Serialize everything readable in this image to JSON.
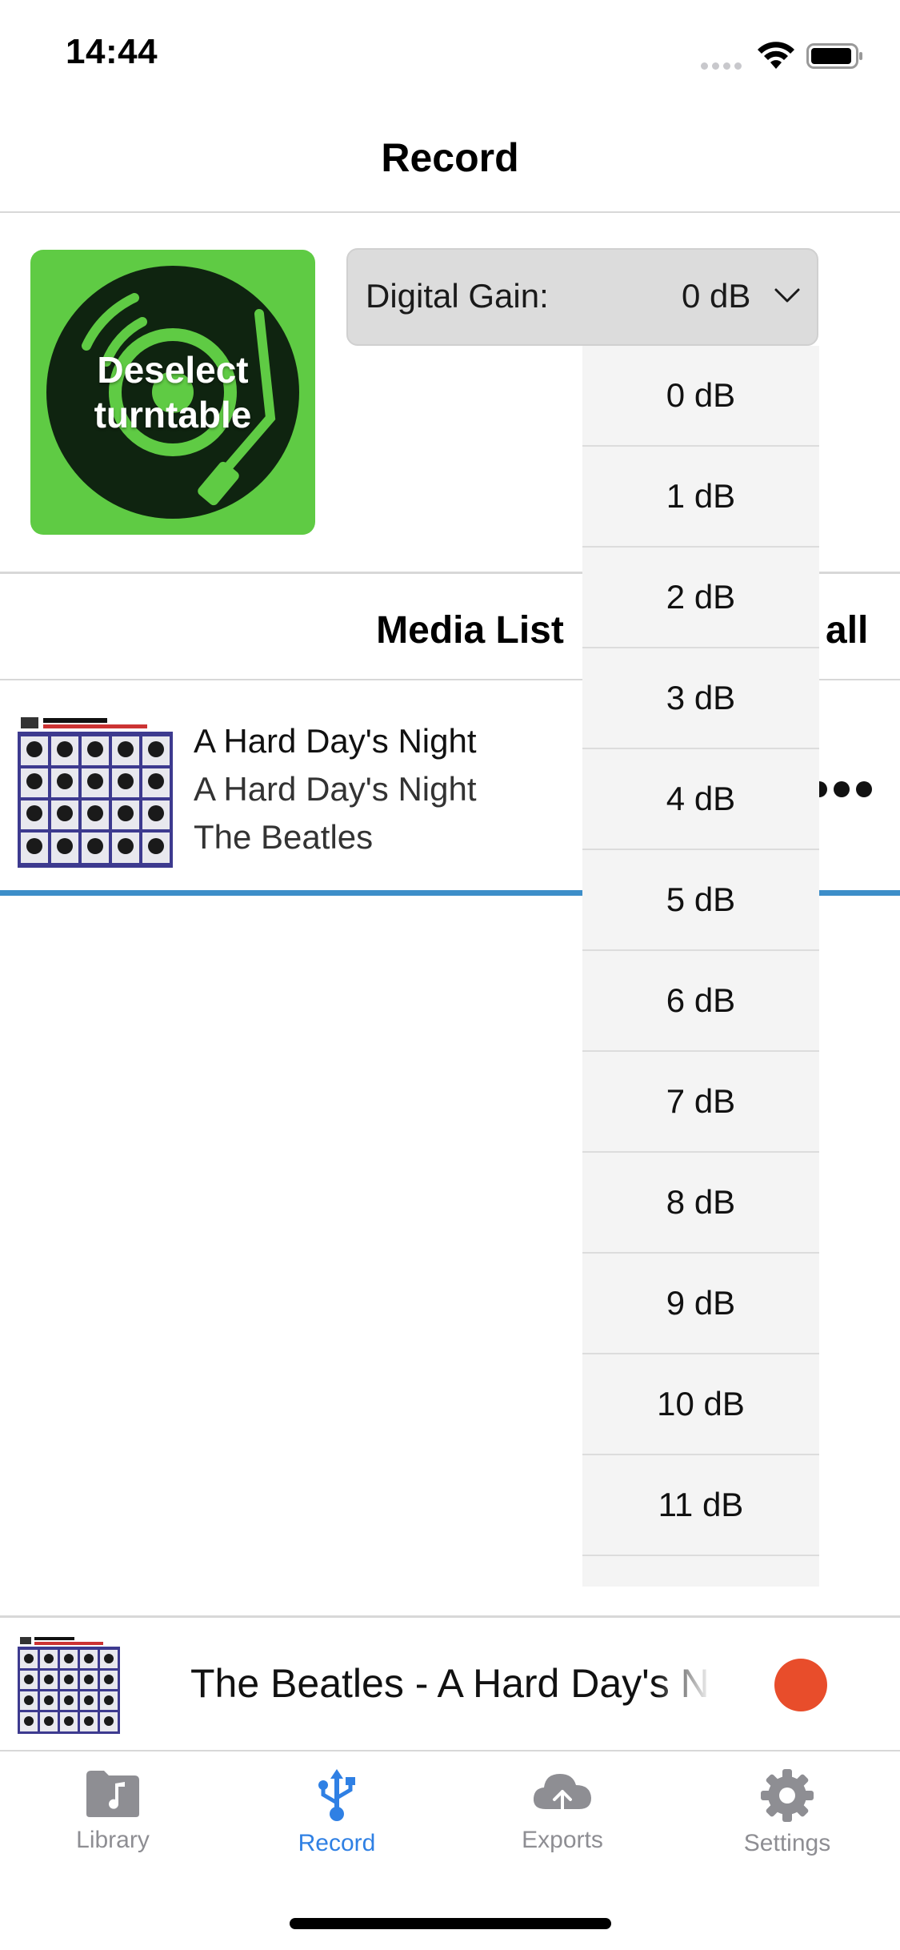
{
  "status_bar": {
    "time": "14:44"
  },
  "nav": {
    "title": "Record"
  },
  "turntable": {
    "label": "Deselect turntable"
  },
  "gain": {
    "label": "Digital Gain:",
    "value": "0 dB"
  },
  "gain_options": [
    "0 dB",
    "1 dB",
    "2 dB",
    "3 dB",
    "4 dB",
    "5 dB",
    "6 dB",
    "7 dB",
    "8 dB",
    "9 dB",
    "10 dB",
    "11 dB"
  ],
  "media_list": {
    "title": "Media List",
    "clear_all": "r all",
    "items": [
      {
        "title": "A Hard Day's Night",
        "album": "A Hard Day's Night",
        "artist": "The Beatles",
        "more_icon": "more-dots-icon"
      }
    ]
  },
  "now_playing": {
    "title": "The Beatles - A Hard Day's Night"
  },
  "tabs": [
    {
      "label": "Library",
      "icon": "folder-music-icon",
      "active": false
    },
    {
      "label": "Record",
      "icon": "usb-icon",
      "active": true
    },
    {
      "label": "Exports",
      "icon": "cloud-upload-icon",
      "active": false
    },
    {
      "label": "Settings",
      "icon": "gear-icon",
      "active": false
    }
  ],
  "colors": {
    "accent": "#2f80e4",
    "turntable_green": "#5fcb44",
    "record_red": "#e84d2b",
    "progress_blue": "#3d8ec9"
  }
}
